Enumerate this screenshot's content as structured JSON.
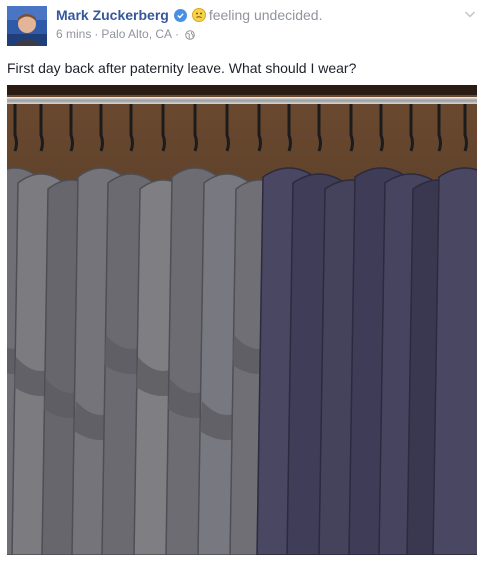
{
  "post": {
    "author": "Mark Zuckerberg",
    "feeling": "feeling undecided.",
    "time": "6 mins",
    "location": "Palo Alto, CA",
    "separator": "·",
    "message": "First day back after paternity leave. What should I wear?"
  },
  "icons": {
    "verified": "verified-badge-icon",
    "feeling": "undecided-face-icon",
    "privacy": "globe-icon",
    "menu": "chevron-down-icon"
  },
  "colors": {
    "author_link": "#365899",
    "meta_text": "#90949c",
    "body_text": "#1d2129",
    "verified_badge": "#4a90e2"
  }
}
